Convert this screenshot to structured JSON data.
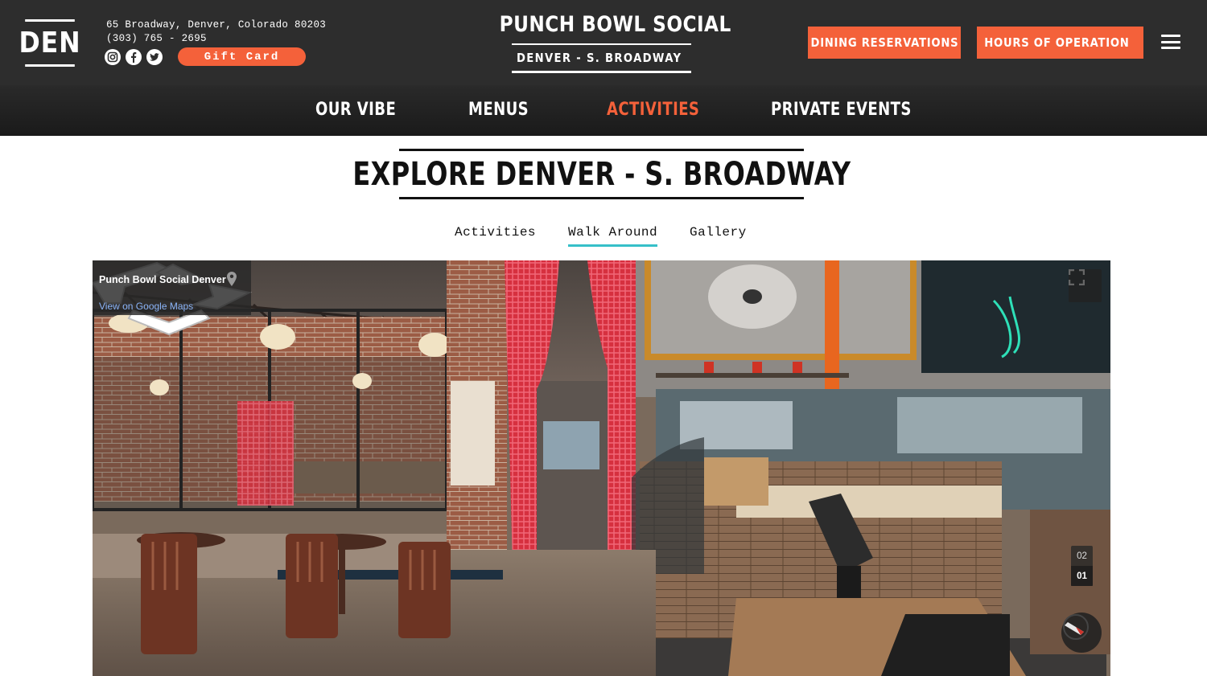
{
  "header": {
    "logo": "DEN",
    "address": "65 Broadway, Denver, Colorado 80203",
    "phone": "(303) 765 - 2695",
    "social_icons": [
      "instagram-icon",
      "facebook-icon",
      "twitter-icon"
    ],
    "gift_card": "Gift Card",
    "brand_title": "PUNCH BOWL SOCIAL",
    "location": "DENVER - S. BROADWAY",
    "dining_reservations": "DINING RESERVATIONS",
    "hours": "HOURS OF OPERATION",
    "accent_color": "#f4613a"
  },
  "nav": {
    "items": [
      {
        "label": "OUR VIBE",
        "active": false
      },
      {
        "label": "MENUS",
        "active": false
      },
      {
        "label": "ACTIVITIES",
        "active": true
      },
      {
        "label": "PRIVATE EVENTS",
        "active": false
      }
    ]
  },
  "explore": {
    "title": "EXPLORE DENVER - S. BROADWAY",
    "tabs": [
      {
        "label": "Activities",
        "active": false
      },
      {
        "label": "Walk Around",
        "active": true
      },
      {
        "label": "Gallery",
        "active": false
      }
    ],
    "tab_underline_color": "#36c0c9"
  },
  "streetview": {
    "place_name": "Punch Bowl Social Denver",
    "maps_link": "View on Google Maps",
    "floors": [
      "02",
      "01"
    ],
    "active_floor": "01"
  }
}
